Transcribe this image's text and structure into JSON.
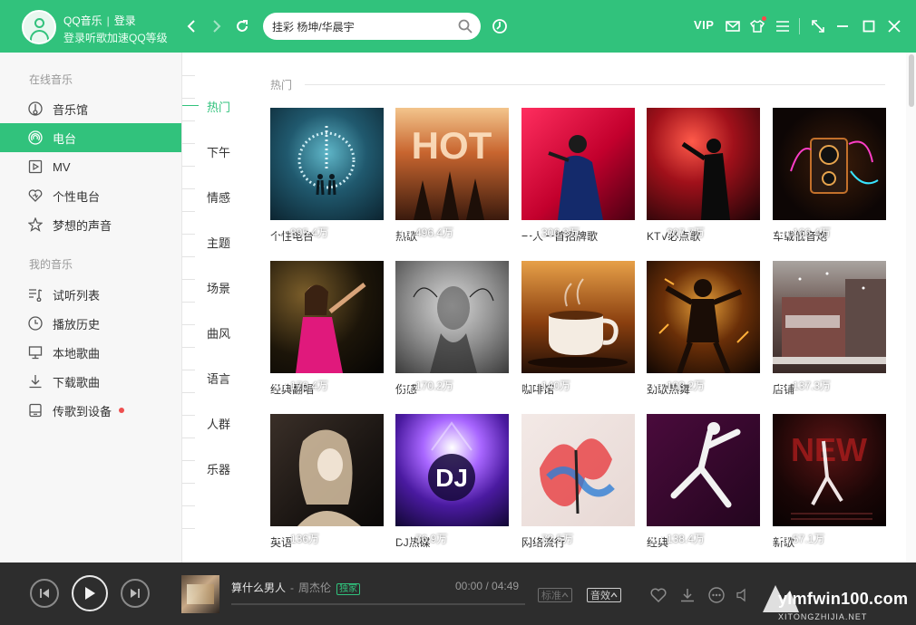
{
  "titlebar": {
    "username": "QQ音乐",
    "login_label": "登录",
    "subtitle": "登录听歌加速QQ等级",
    "vip_label": "VIP"
  },
  "search": {
    "value": "挂彩 杨坤/华晨宇"
  },
  "sidebar": {
    "section_online": "在线音乐",
    "section_mine": "我的音乐",
    "items": [
      {
        "label": "音乐馆",
        "icon": "music-hall-icon"
      },
      {
        "label": "电台",
        "icon": "radio-icon",
        "active": true
      },
      {
        "label": "MV",
        "icon": "mv-icon"
      },
      {
        "label": "个性电台",
        "icon": "heart-radio-icon"
      },
      {
        "label": "梦想的声音",
        "icon": "star-icon"
      },
      {
        "label": "试听列表",
        "icon": "playlist-icon"
      },
      {
        "label": "播放历史",
        "icon": "history-icon"
      },
      {
        "label": "本地歌曲",
        "icon": "computer-icon"
      },
      {
        "label": "下载歌曲",
        "icon": "download-icon"
      },
      {
        "label": "传歌到设备",
        "icon": "device-icon"
      }
    ]
  },
  "categories": [
    "热门",
    "下午",
    "情感",
    "主题",
    "场景",
    "曲风",
    "语言",
    "人群",
    "乐器"
  ],
  "main": {
    "section_title": "热门",
    "tiles": [
      {
        "name": "个性电台",
        "plays": "895.4万"
      },
      {
        "name": "热歌",
        "plays": "496.4万"
      },
      {
        "name": "一人一首招牌歌",
        "plays": "306.3万"
      },
      {
        "name": "KTV必点歌",
        "plays": "207.7万"
      },
      {
        "name": "车载低音炮",
        "plays": "166.4万"
      },
      {
        "name": "经典翻唱",
        "plays": "170.4万"
      },
      {
        "name": "伤感",
        "plays": "170.2万"
      },
      {
        "name": "咖啡馆",
        "plays": "140万"
      },
      {
        "name": "劲歌热舞",
        "plays": "103.2万"
      },
      {
        "name": "店铺",
        "plays": "137.3万"
      },
      {
        "name": "英语",
        "plays": "136万"
      },
      {
        "name": "DJ热碟",
        "plays": "76.9万"
      },
      {
        "name": "网络流行",
        "plays": "72.5万"
      },
      {
        "name": "经典",
        "plays": "138.4万"
      },
      {
        "name": "新歌",
        "plays": "57.1万"
      }
    ]
  },
  "player": {
    "song": "算什么男人",
    "artist": "周杰伦",
    "tag": "独家",
    "current_time": "00:00",
    "total_time": "04:49",
    "progress": 0,
    "quality_label": "标准",
    "effect_label": "音效"
  },
  "watermark": {
    "text": "ylmfwin100.com",
    "sub": "XITONGZHIJIA.NET"
  },
  "colors": {
    "accent": "#31c27c",
    "player_bg": "#2d2d2d"
  }
}
